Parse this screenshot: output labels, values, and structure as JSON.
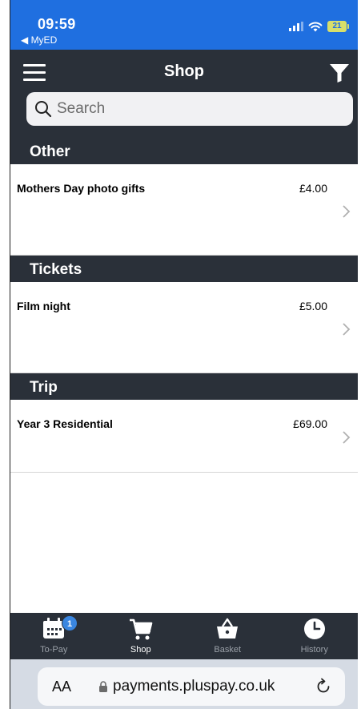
{
  "status_bar": {
    "time": "09:59",
    "back_app": "◀ MyED",
    "battery": "21"
  },
  "header": {
    "title": "Shop"
  },
  "search": {
    "placeholder": "Search"
  },
  "sections": [
    {
      "title": "Other",
      "items": [
        {
          "name": "Mothers Day photo gifts",
          "price": "£4.00"
        }
      ]
    },
    {
      "title": "Tickets",
      "items": [
        {
          "name": "Film night",
          "price": "£5.00"
        }
      ]
    },
    {
      "title": "Trip",
      "items": [
        {
          "name": "Year 3 Residential",
          "price": "£69.00"
        }
      ]
    }
  ],
  "tabs": [
    {
      "label": "To-Pay",
      "icon": "calendar-icon",
      "badge": "1"
    },
    {
      "label": "Shop",
      "icon": "cart-icon",
      "active": true
    },
    {
      "label": "Basket",
      "icon": "basket-icon"
    },
    {
      "label": "History",
      "icon": "clock-icon"
    }
  ],
  "browser": {
    "text_size_label": "AA",
    "url": "payments.pluspay.co.uk"
  },
  "colors": {
    "status_bar": "#1f6fe0",
    "header_bg": "#2a3039",
    "badge": "#3a86e0"
  }
}
